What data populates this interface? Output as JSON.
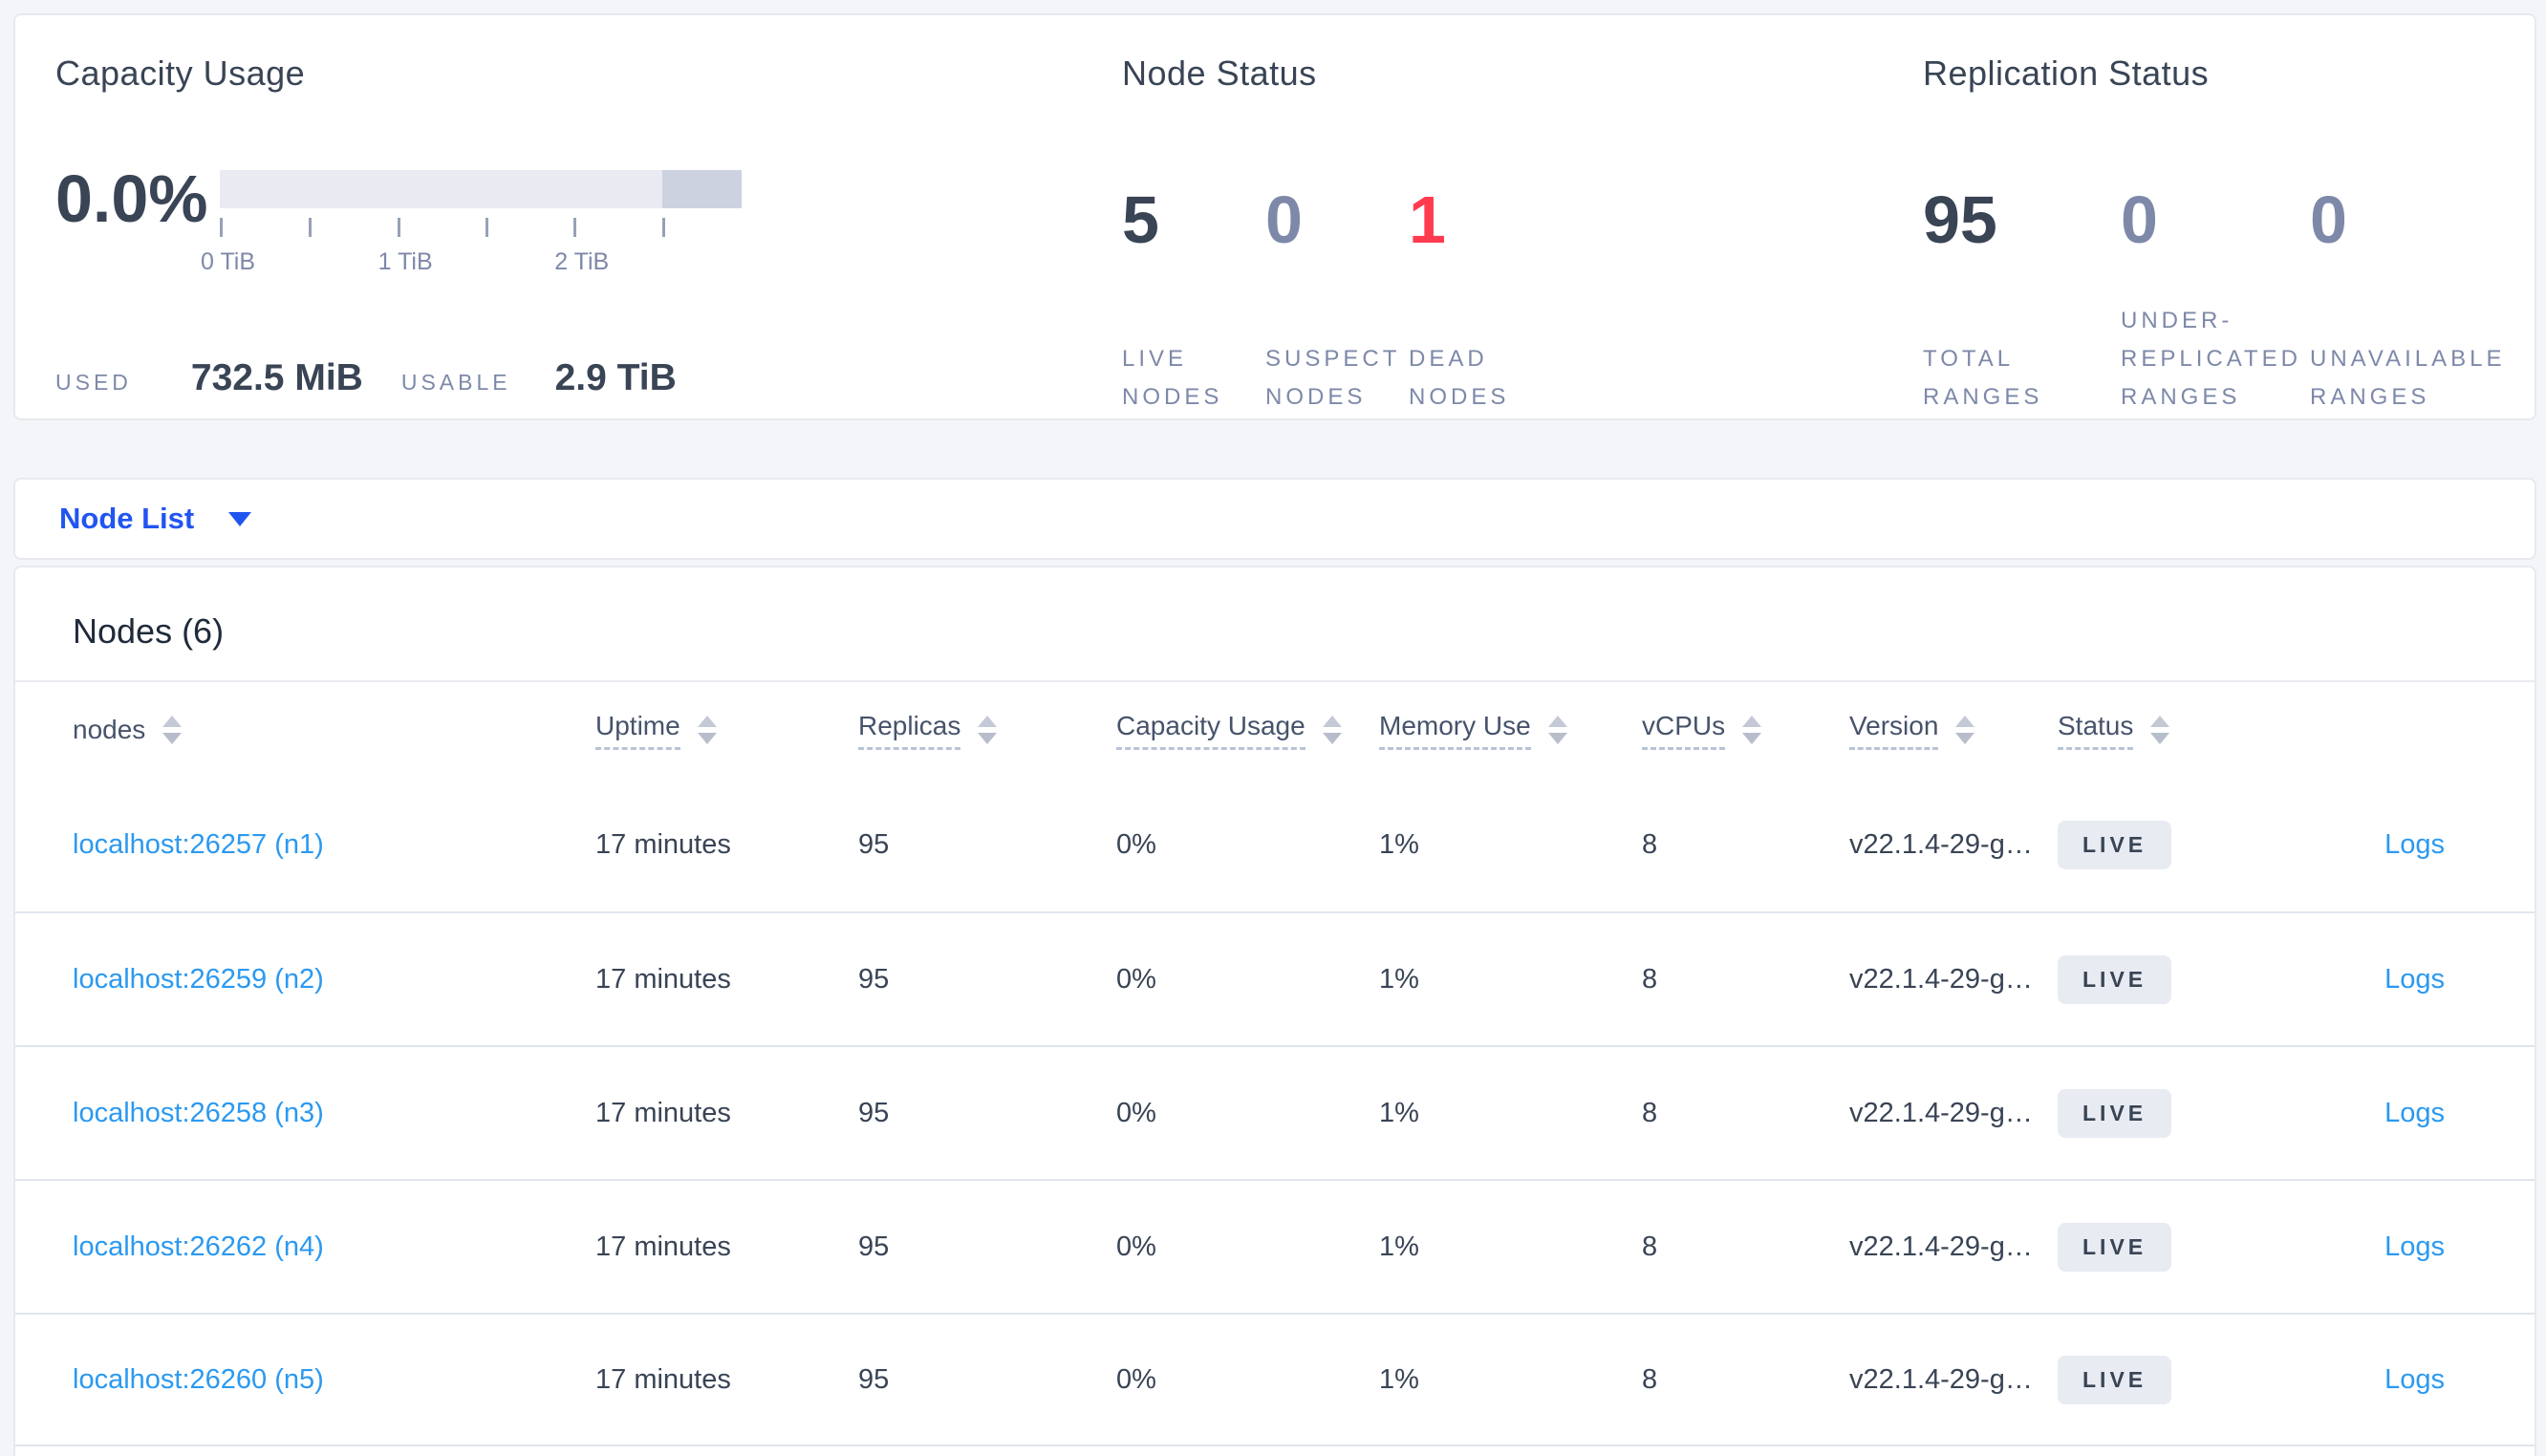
{
  "capacity": {
    "title": "Capacity Usage",
    "percent": "0.0%",
    "bar": {
      "track_color": "#e9eaf2",
      "used_segment_color": "#cdd2e0",
      "segment_start_pct": 84.8
    },
    "ticks": [
      {
        "label": "0 TiB",
        "pos_pct": 0
      },
      {
        "label": "",
        "pos_pct": 17
      },
      {
        "label": "1 TiB",
        "pos_pct": 34
      },
      {
        "label": "",
        "pos_pct": 50.9
      },
      {
        "label": "2 TiB",
        "pos_pct": 67.8
      },
      {
        "label": "",
        "pos_pct": 84.8
      }
    ],
    "used_label": "USED",
    "used_value": "732.5 MiB",
    "usable_label": "USABLE",
    "usable_value": "2.9 TiB"
  },
  "node_status": {
    "title": "Node Status",
    "stats": [
      {
        "value": "5",
        "label": "LIVE\nNODES",
        "color": "#394455",
        "width": "w150"
      },
      {
        "value": "0",
        "label": "SUSPECT\nNODES",
        "color": "#7e89a9",
        "width": "w150"
      },
      {
        "value": "1",
        "label": "DEAD\nNODES",
        "color": "#ff3b4f",
        "width": "w150"
      }
    ]
  },
  "replication_status": {
    "title": "Replication Status",
    "stats": [
      {
        "value": "95",
        "label": "TOTAL\nRANGES",
        "color": "#394455",
        "width": "w207"
      },
      {
        "value": "0",
        "label": "UNDER-\nREPLICATED\nRANGES",
        "color": "#7e89a9",
        "width": "w198"
      },
      {
        "value": "0",
        "label": "UNAVAILABLE\nRANGES",
        "color": "#7e89a9",
        "width": "w230"
      }
    ]
  },
  "node_list": {
    "label": "Node List"
  },
  "nodes_table": {
    "heading": "Nodes (6)",
    "columns": [
      {
        "key": "node",
        "label": "nodes",
        "underline": false
      },
      {
        "key": "uptime",
        "label": "Uptime",
        "underline": true
      },
      {
        "key": "replicas",
        "label": "Replicas",
        "underline": true
      },
      {
        "key": "capacity",
        "label": "Capacity Usage",
        "underline": true
      },
      {
        "key": "memory",
        "label": "Memory Use",
        "underline": true
      },
      {
        "key": "vcpus",
        "label": "vCPUs",
        "underline": true
      },
      {
        "key": "version",
        "label": "Version",
        "underline": true
      },
      {
        "key": "status",
        "label": "Status",
        "underline": true
      }
    ],
    "logs_label": "Logs",
    "rows": [
      {
        "node": "localhost:26257 (n1)",
        "uptime": "17 minutes",
        "replicas": "95",
        "capacity": "0%",
        "memory": "1%",
        "vcpus": "8",
        "version": "v22.1.4-29-g…",
        "status": "LIVE"
      },
      {
        "node": "localhost:26259 (n2)",
        "uptime": "17 minutes",
        "replicas": "95",
        "capacity": "0%",
        "memory": "1%",
        "vcpus": "8",
        "version": "v22.1.4-29-g…",
        "status": "LIVE"
      },
      {
        "node": "localhost:26258 (n3)",
        "uptime": "17 minutes",
        "replicas": "95",
        "capacity": "0%",
        "memory": "1%",
        "vcpus": "8",
        "version": "v22.1.4-29-g…",
        "status": "LIVE"
      },
      {
        "node": "localhost:26262 (n4)",
        "uptime": "17 minutes",
        "replicas": "95",
        "capacity": "0%",
        "memory": "1%",
        "vcpus": "8",
        "version": "v22.1.4-29-g…",
        "status": "LIVE"
      },
      {
        "node": "localhost:26260 (n5)",
        "uptime": "17 minutes",
        "replicas": "95",
        "capacity": "0%",
        "memory": "1%",
        "vcpus": "8",
        "version": "v22.1.4-29-g…",
        "status": "LIVE"
      }
    ]
  }
}
